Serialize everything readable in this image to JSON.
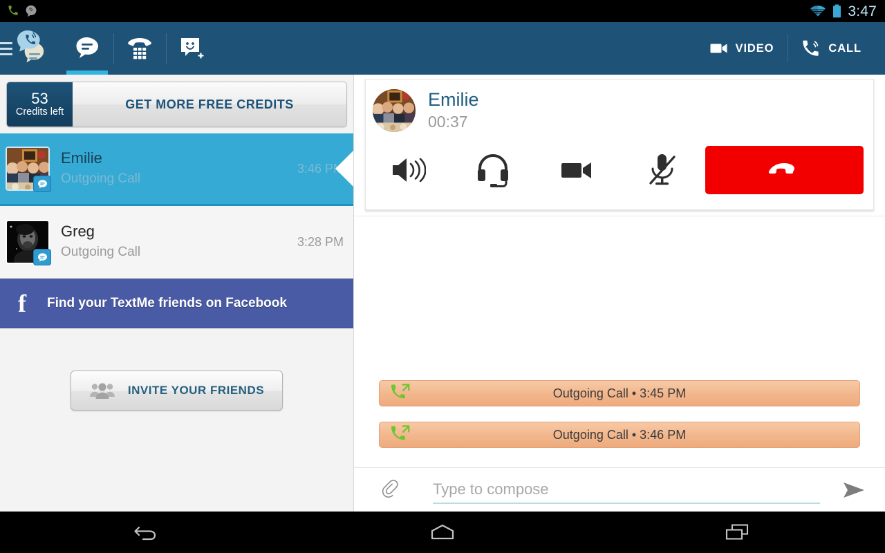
{
  "statusbar": {
    "time": "3:47",
    "icons": [
      "phone-green-icon",
      "app-notification-icon",
      "wifi-icon",
      "battery-icon"
    ]
  },
  "actionbar": {
    "menu_icon": "hamburger-menu-icon",
    "logo_icon": "textme-logo-icon",
    "tabs": [
      {
        "name": "tab-messages",
        "icon": "chat-bubble-icon",
        "active": true
      },
      {
        "name": "tab-dialer",
        "icon": "dialpad-phone-icon",
        "active": false
      },
      {
        "name": "tab-new-contact",
        "icon": "smiley-add-icon",
        "active": false
      }
    ],
    "actions": [
      {
        "name": "video-button",
        "label": "VIDEO",
        "icon": "video-camera-icon"
      },
      {
        "name": "call-button",
        "label": "CALL",
        "icon": "phone-call-icon"
      }
    ]
  },
  "sidebar": {
    "credits": {
      "count": "53",
      "label": "Credits left",
      "cta": "GET MORE FREE CREDITS"
    },
    "conversations": [
      {
        "name": "Emilie",
        "preview": "Outgoing Call",
        "time": "3:46 PM",
        "selected": true,
        "avatar": "group-dinner-photo",
        "badge": "sms-bubble-badge"
      },
      {
        "name": "Greg",
        "preview": "Outgoing Call",
        "time": "3:28 PM",
        "selected": false,
        "avatar": "man-portrait-photo",
        "badge": "sms-bubble-badge"
      }
    ],
    "facebook_banner": {
      "icon": "facebook-f-icon",
      "label": "Find your TextMe friends on Facebook"
    },
    "invite_button": {
      "icon": "people-group-icon",
      "label": "INVITE YOUR FRIENDS"
    }
  },
  "call_panel": {
    "contact_name": "Emilie",
    "duration": "00:37",
    "avatar": "group-dinner-photo",
    "controls": [
      {
        "name": "speaker-button",
        "icon": "speaker-icon",
        "state": "off"
      },
      {
        "name": "headset-button",
        "icon": "headset-icon",
        "state": "off"
      },
      {
        "name": "video-toggle-button",
        "icon": "video-camera-icon",
        "state": "off"
      },
      {
        "name": "mute-button",
        "icon": "microphone-muted-icon",
        "state": "muted"
      }
    ],
    "hangup": {
      "name": "hangup-button",
      "icon": "hangup-phone-icon",
      "color": "#f20000"
    }
  },
  "conversation": {
    "events": [
      {
        "icon": "outgoing-call-icon",
        "text": "Outgoing Call • 3:45 PM"
      },
      {
        "icon": "outgoing-call-icon",
        "text": "Outgoing Call • 3:46 PM"
      }
    ]
  },
  "composer": {
    "attach_icon": "paperclip-icon",
    "placeholder": "Type to compose",
    "value": "",
    "send_icon": "send-arrow-icon"
  },
  "navbar": {
    "buttons": [
      {
        "name": "nav-back-button",
        "icon": "back-arrow-icon"
      },
      {
        "name": "nav-home-button",
        "icon": "home-icon"
      },
      {
        "name": "nav-recents-button",
        "icon": "recent-apps-icon"
      }
    ]
  },
  "colors": {
    "actionbar": "#1f5277",
    "accent": "#33b4e0",
    "selected_row": "#34aad5",
    "facebook": "#4a5ba6",
    "hangup_red": "#f20000",
    "call_event": "#f2b68c"
  }
}
